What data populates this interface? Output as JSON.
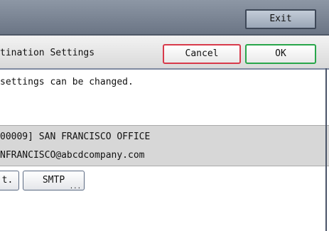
{
  "header": {
    "exit_label": "Exit"
  },
  "dialog": {
    "title": "tination Settings",
    "cancel_label": "Cancel",
    "ok_label": "OK",
    "info": "settings can be changed."
  },
  "destination": {
    "name_line": "00009] SAN FRANCISCO OFFICE",
    "email_line": "NFRANCISCO@abcdcompany.com"
  },
  "buttons": {
    "format_label": "t.",
    "smtp_label": "SMTP",
    "smtp_suffix": "..."
  },
  "colors": {
    "cancel_border": "#d83a4b",
    "ok_border": "#28a64a",
    "top_bar": "#6b7585"
  }
}
